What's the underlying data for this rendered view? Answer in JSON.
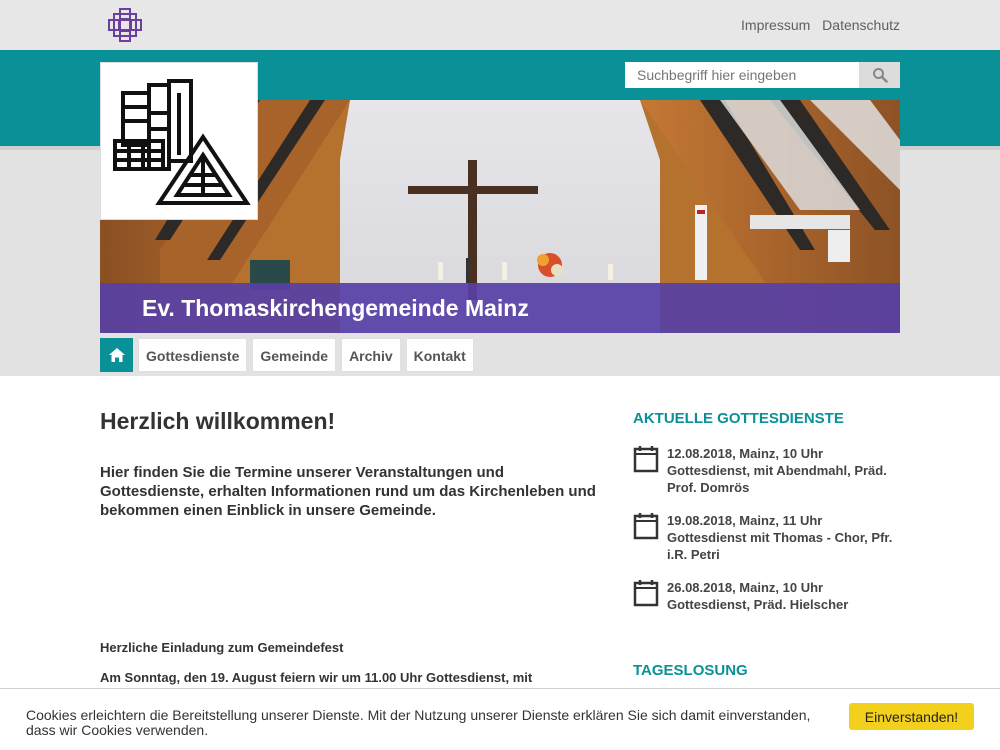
{
  "topbar": {
    "links": [
      "Impressum",
      "Datenschutz"
    ]
  },
  "search": {
    "placeholder": "Suchbegriff hier eingeben"
  },
  "hero": {
    "title": "Ev. Thomaskirchengemeinde Mainz"
  },
  "nav": {
    "items": [
      "Gottesdienste",
      "Gemeinde",
      "Archiv",
      "Kontakt"
    ]
  },
  "main": {
    "heading": "Herzlich willkommen!",
    "intro": "Hier finden Sie die Termine unserer Veranstaltungen und Gottesdienste, erhalten Informationen rund um das Kirchenleben und bekommen einen Einblick in unsere Gemeinde.",
    "invite_title": "Herzliche Einladung zum Gemeindefest",
    "invite_text": "Am Sonntag, den 19.  August feiern wir um 11.00 Uhr Gottesdienst, mit"
  },
  "sidebar": {
    "services_heading": "AKTUELLE GOTTESDIENSTE",
    "events": [
      {
        "date": "12.08.2018, Mainz, 10 Uhr",
        "desc": "Gottesdienst, mit Abendmahl, Präd. Prof. Domrös"
      },
      {
        "date": "19.08.2018, Mainz, 11 Uhr",
        "desc": "Gottesdienst mit Thomas - Chor, Pfr. i.R. Petri"
      },
      {
        "date": "26.08.2018, Mainz, 10 Uhr",
        "desc": "Gottesdienst, Präd. Hielscher"
      }
    ],
    "losung_heading": "TAGESLOSUNG"
  },
  "cookie": {
    "text": "Cookies erleichtern die Bereitstellung unserer Dienste. Mit der Nutzung unserer Dienste erklären Sie sich damit einverstanden, dass wir Cookies verwenden.",
    "button": "Einverstanden!"
  },
  "colors": {
    "teal": "#0a9197",
    "purple": "#5840a6",
    "button_yellow": "#f3d01c"
  },
  "icons": [
    "ekd-cross-logo",
    "search-icon",
    "home-icon",
    "calendar-icon",
    "church-logo"
  ]
}
